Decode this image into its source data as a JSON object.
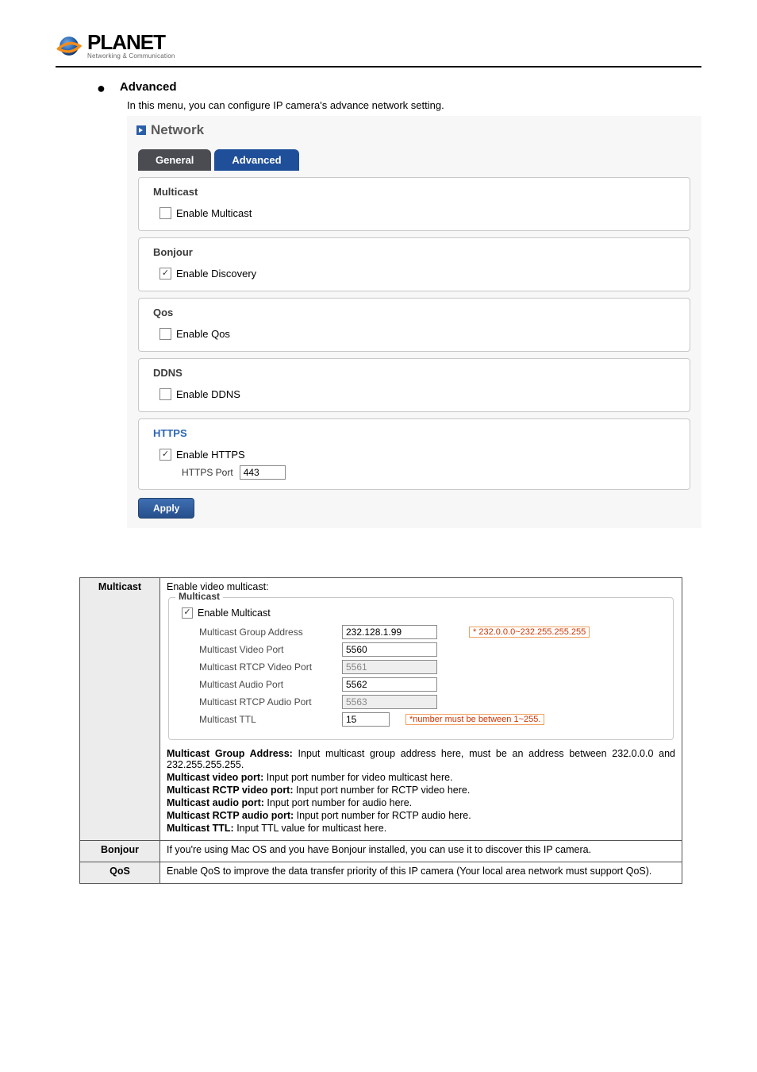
{
  "logo": {
    "name": "PLANET",
    "tagline": "Networking & Communication"
  },
  "section": {
    "title": "Advanced",
    "desc": "In this menu, you can configure IP camera's advance network setting."
  },
  "panel": {
    "title": "Network",
    "tabs": {
      "general": "General",
      "advanced": "Advanced"
    },
    "multicast": {
      "legend": "Multicast",
      "enable_label": "Enable Multicast",
      "checked": false
    },
    "bonjour": {
      "legend": "Bonjour",
      "enable_label": "Enable Discovery",
      "checked": true
    },
    "qos": {
      "legend": "Qos",
      "enable_label": "Enable Qos",
      "checked": false
    },
    "ddns": {
      "legend": "DDNS",
      "enable_label": "Enable DDNS",
      "checked": false
    },
    "https": {
      "legend": "HTTPS",
      "enable_label": "Enable HTTPS",
      "checked": true,
      "port_label": "HTTPS Port",
      "port_value": "443"
    },
    "apply": "Apply"
  },
  "table": {
    "multicast": {
      "label": "Multicast",
      "intro": "Enable video multicast:",
      "box_legend": "Multicast",
      "enable_label": "Enable Multicast",
      "rows": {
        "group_addr": {
          "label": "Multicast Group Address",
          "value": "232.128.1.99",
          "hint": "* 232.0.0.0~232.255.255.255"
        },
        "video_port": {
          "label": "Multicast Video Port",
          "value": "5560"
        },
        "rtcp_video_port": {
          "label": "Multicast RTCP Video Port",
          "value": "5561"
        },
        "audio_port": {
          "label": "Multicast Audio Port",
          "value": "5562"
        },
        "rtcp_audio_port": {
          "label": "Multicast RTCP Audio Port",
          "value": "5563"
        },
        "ttl": {
          "label": "Multicast TTL",
          "value": "15",
          "hint": "*number must be between 1~255."
        }
      },
      "desc": {
        "ga1": "Multicast Group Address:",
        "ga2": " Input multicast group address here, must be an address between 232.0.0.0 and 232.255.255.255.",
        "vp1": "Multicast video port:",
        "vp2": " Input port number for video multicast here.",
        "rvp1": "Multicast RCTP video port:",
        "rvp2": " Input port number for RCTP video here.",
        "ap1": "Multicast audio port:",
        "ap2": " Input port number for audio here.",
        "rap1": "Multicast RCTP audio port:",
        "rap2": " Input port number for RCTP audio here.",
        "ttl1": "Multicast TTL:",
        "ttl2": " Input TTL value for multicast here."
      }
    },
    "bonjour": {
      "label": "Bonjour",
      "text": "If you're using Mac OS and you have Bonjour installed, you can use it to discover this IP camera."
    },
    "qos": {
      "label": "QoS",
      "text": "Enable QoS to improve the data transfer priority of this IP camera (Your local area network must support QoS)."
    }
  }
}
